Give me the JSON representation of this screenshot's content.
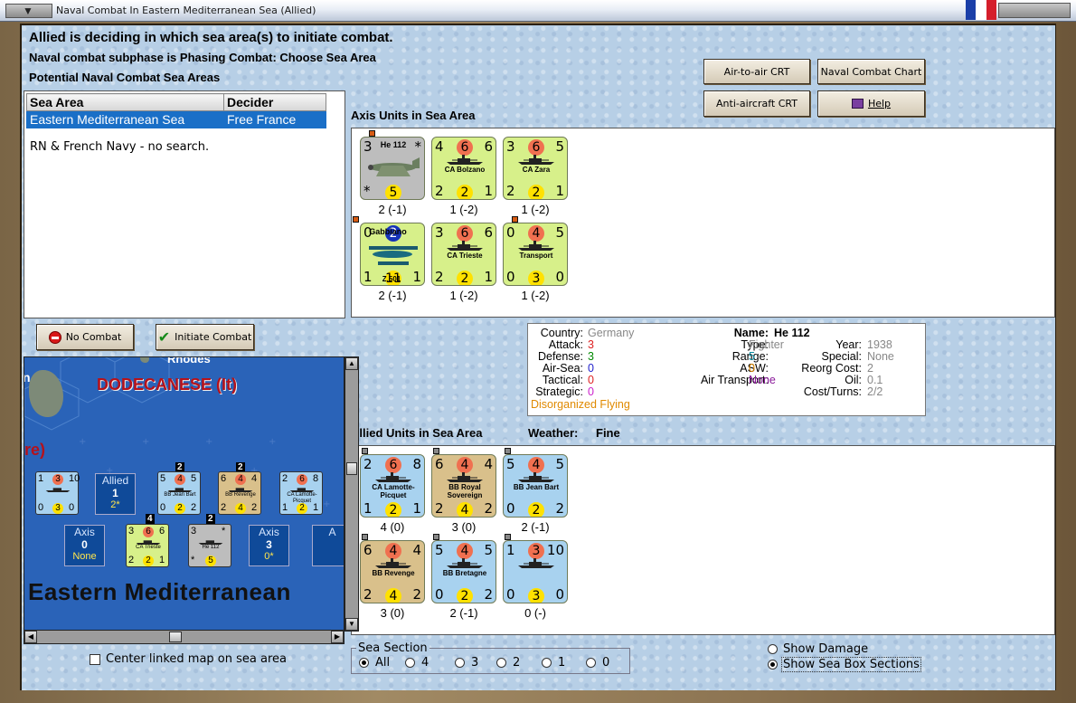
{
  "window": {
    "title": "Naval Combat In Eastern Mediterranean Sea (Allied)",
    "flag_colors": [
      "#1b3fa8",
      "#ffffff",
      "#d51e2b"
    ]
  },
  "header": {
    "line1": "Allied is deciding in which sea area(s) to initiate combat.",
    "line2": "Naval combat subphase is Phasing Combat: Choose Sea Area",
    "line3": "Potential Naval Combat Sea Areas"
  },
  "buttons": {
    "air_to_air": "Air-to-air CRT",
    "naval_chart": "Naval Combat Chart",
    "anti_aircraft": "Anti-aircraft CRT",
    "help": "Help",
    "no_combat": "No Combat",
    "initiate": "Initiate Combat"
  },
  "sea_table": {
    "headers": [
      "Sea Area",
      "Decider"
    ],
    "row": {
      "area": "Eastern Mediterranean Sea",
      "decider": "Free France"
    },
    "note": "RN & French Navy - no search."
  },
  "axis_section": {
    "label": "Axis Units in Sea Area",
    "units": [
      {
        "name": "He 112",
        "tl": "3",
        "tm": "",
        "tr": "*",
        "bl": "*",
        "bm": "5",
        "br": "",
        "status": "2 (-1)",
        "color": "grey"
      },
      {
        "name": "CA Bolzano",
        "tl": "4",
        "tm": "6",
        "tr": "6",
        "bl": "2",
        "bm": "2",
        "br": "1",
        "status": "1 (-2)",
        "color": "green"
      },
      {
        "name": "CA Zara",
        "tl": "3",
        "tm": "6",
        "tr": "5",
        "bl": "2",
        "bm": "2",
        "br": "1",
        "status": "1 (-2)",
        "color": "green"
      },
      {
        "name": "Gabbiano",
        "name2": "Z.501",
        "tl": "0",
        "tm": "2",
        "tr": "",
        "bl": "1",
        "bm": "11",
        "br": "1",
        "status": "2 (-1)",
        "color": "green"
      },
      {
        "name": "CA Trieste",
        "tl": "3",
        "tm": "6",
        "tr": "6",
        "bl": "2",
        "bm": "2",
        "br": "1",
        "status": "1 (-2)",
        "color": "green"
      },
      {
        "name": "Transport",
        "tl": "0",
        "tm": "4",
        "tr": "5",
        "bl": "0",
        "bm": "3",
        "br": "0",
        "status": "1 (-2)",
        "color": "green"
      }
    ]
  },
  "info": {
    "country_lbl": "Country:",
    "country": "Germany",
    "attack_lbl": "Attack:",
    "attack": "3",
    "defense_lbl": "Defense:",
    "defense": "3",
    "airsea_lbl": "Air-Sea:",
    "airsea": "0",
    "tactical_lbl": "Tactical:",
    "tactical": "0",
    "strategic_lbl": "Strategic:",
    "strategic": "0",
    "flying": "Disorganized Flying",
    "name_lbl": "Name:",
    "name": "He 112",
    "type_lbl": "Type:",
    "type": "Fighter",
    "range_lbl": "Range:",
    "range": "5",
    "asw_lbl": "ASW:",
    "asw": "0",
    "airtr_lbl": "Air Transport:",
    "airtr": "None",
    "year_lbl": "Year:",
    "year": "1938",
    "special_lbl": "Special:",
    "special": "None",
    "reorg_lbl": "Reorg Cost:",
    "reorg": "2",
    "oil_lbl": "Oil:",
    "oil": "0.1",
    "cost_lbl": "Cost/Turns:",
    "cost": "2/2"
  },
  "allied_section": {
    "label": "Allied Units in Sea Area",
    "weather_lbl": "Weather:",
    "weather": "Fine",
    "units": [
      {
        "name": "CA Lamotte-Picquet",
        "tl": "2",
        "tm": "6",
        "tr": "8",
        "bl": "1",
        "bm": "2",
        "br": "1",
        "status": "4 (0)",
        "color": "blue"
      },
      {
        "name": "BB Royal Sovereign",
        "tl": "6",
        "tm": "4",
        "tr": "4",
        "bl": "2",
        "bm": "4",
        "br": "2",
        "status": "3 (0)",
        "color": "tan"
      },
      {
        "name": "BB Jean Bart",
        "tl": "5",
        "tm": "4",
        "tr": "5",
        "bl": "0",
        "bm": "2",
        "br": "2",
        "status": "2 (-1)",
        "color": "blue"
      },
      {
        "name": "BB Revenge",
        "tl": "6",
        "tm": "4",
        "tr": "4",
        "bl": "2",
        "bm": "4",
        "br": "2",
        "status": "3 (0)",
        "color": "tan"
      },
      {
        "name": "BB Bretagne",
        "tl": "5",
        "tm": "4",
        "tr": "5",
        "bl": "0",
        "bm": "2",
        "br": "2",
        "status": "2 (-1)",
        "color": "blue"
      },
      {
        "name": "",
        "tl": "1",
        "tm": "3",
        "tr": "10",
        "bl": "0",
        "bm": "3",
        "br": "0",
        "status": "0 (-)",
        "color": "blue"
      }
    ]
  },
  "map": {
    "rhodes": "Rhodes",
    "dodecanese": "DODECANESE (It)",
    "partial": "re)",
    "sea_name": "Eastern Mediterranean",
    "n_letter": "n",
    "allied_box": {
      "label": "Allied",
      "num": "1",
      "sub": "2*"
    },
    "axis_box0": {
      "label": "Axis",
      "num": "0",
      "sub": "None"
    },
    "axis_box3": {
      "label": "Axis",
      "num": "3",
      "sub": "0*"
    },
    "axis_box4": {
      "label": "A"
    },
    "stack_counts": {
      "jb": "2",
      "rev": "2",
      "tri": "4",
      "he": "2"
    },
    "units": [
      {
        "name": "",
        "t": [
          "1",
          "3",
          "10"
        ],
        "b": [
          "0",
          "3",
          "0"
        ]
      },
      {
        "name": "BB Jean Bart",
        "t": [
          "5",
          "4",
          "5"
        ],
        "b": [
          "0",
          "2",
          "2"
        ]
      },
      {
        "name": "BB Revenge",
        "t": [
          "6",
          "4",
          "4"
        ],
        "b": [
          "2",
          "4",
          "2"
        ]
      },
      {
        "name": "CA Lamotte-Picquet",
        "t": [
          "2",
          "6",
          "8"
        ],
        "b": [
          "1",
          "2",
          "1"
        ]
      },
      {
        "name": "CA Trieste",
        "t": [
          "3",
          "6",
          "6"
        ],
        "b": [
          "2",
          "2",
          "1"
        ]
      },
      {
        "name": "He 112",
        "t": [
          "3",
          "",
          "*"
        ],
        "b": [
          "*",
          "5",
          ""
        ]
      }
    ]
  },
  "center_linked": "Center linked map on sea area",
  "sea_section": {
    "label": "Sea Section",
    "options": [
      "All",
      "4",
      "3",
      "2",
      "1",
      "0"
    ],
    "selected": "All"
  },
  "display_options": {
    "show_damage": "Show Damage",
    "show_sections": "Show Sea Box Sections"
  }
}
